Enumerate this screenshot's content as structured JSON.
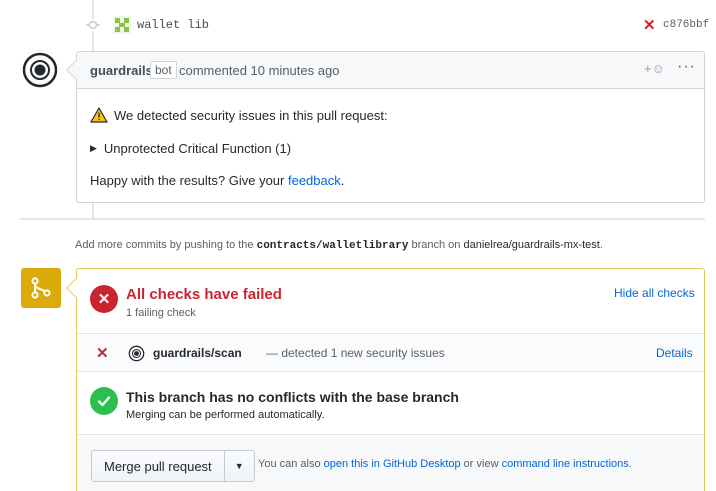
{
  "commit": {
    "title": "wallet lib",
    "sha": "c876bbf",
    "status_icon": "x-icon"
  },
  "comment": {
    "author": "guardrails",
    "badge": "bot",
    "meta": "commented 10 minutes ago",
    "reaction": "+☺",
    "more": "···",
    "warning_text": "We detected security issues in this pull request:",
    "details_summary": "Unprotected Critical Function (1)",
    "happy_prefix": "Happy with the results? Give your ",
    "happy_link": "feedback",
    "happy_suffix": "."
  },
  "add_commits": {
    "prefix": "Add more commits by pushing to the ",
    "branch": "contracts/walletlibrary",
    "middle": " branch on ",
    "repo": "danielrea/guardrails-mx-test",
    "suffix": "."
  },
  "checks": {
    "title": "All checks have failed",
    "subtitle": "1 failing check",
    "toggle_label": "Hide all checks",
    "items": [
      {
        "name": "guardrails/scan",
        "description": "— detected 1 new security issues",
        "details_label": "Details",
        "status": "failed"
      }
    ]
  },
  "conflicts": {
    "title": "This branch has no conflicts with the base branch",
    "subtitle": "Merging can be performed automatically."
  },
  "merge": {
    "button_label": "Merge pull request",
    "help_prefix": "You can also ",
    "help_link1": "open this in GitHub Desktop",
    "help_middle": " or view ",
    "help_link2": "command line instructions",
    "help_suffix": "."
  },
  "colors": {
    "fail": "#cb2431",
    "success": "#2cbe4e",
    "warning": "#dbab09",
    "link": "#0366d6"
  }
}
